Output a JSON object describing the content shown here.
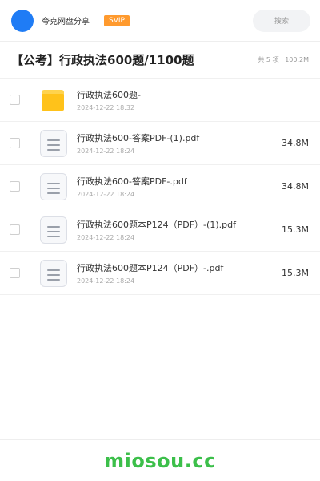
{
  "header": {
    "username": "夸克网盘分享",
    "badge": "SVIP",
    "search_label": "搜索",
    "avatar_color": "#1f7cf5"
  },
  "share": {
    "title": "【公考】行政执法600题/1100题",
    "meta": "共 5 项 · 100.2M"
  },
  "files": [
    {
      "name": "行政执法600题-",
      "date": "2024-12-22 18:32",
      "size": "",
      "type": "folder-icon"
    },
    {
      "name": "行政执法600-答案PDF-(1).pdf",
      "date": "2024-12-22 18:24",
      "size": "34.8M",
      "type": "document-icon"
    },
    {
      "name": "行政执法600-答案PDF-.pdf",
      "date": "2024-12-22 18:24",
      "size": "34.8M",
      "type": "document-icon"
    },
    {
      "name": "行政执法600题本P124（PDF）-(1).pdf",
      "date": "2024-12-22 18:24",
      "size": "15.3M",
      "type": "document-icon"
    },
    {
      "name": "行政执法600题本P124（PDF）-.pdf",
      "date": "2024-12-22 18:24",
      "size": "15.3M",
      "type": "document-icon"
    }
  ],
  "footer": {
    "watermark": "miosou.cc",
    "watermark_color": "#3cbf4a"
  }
}
